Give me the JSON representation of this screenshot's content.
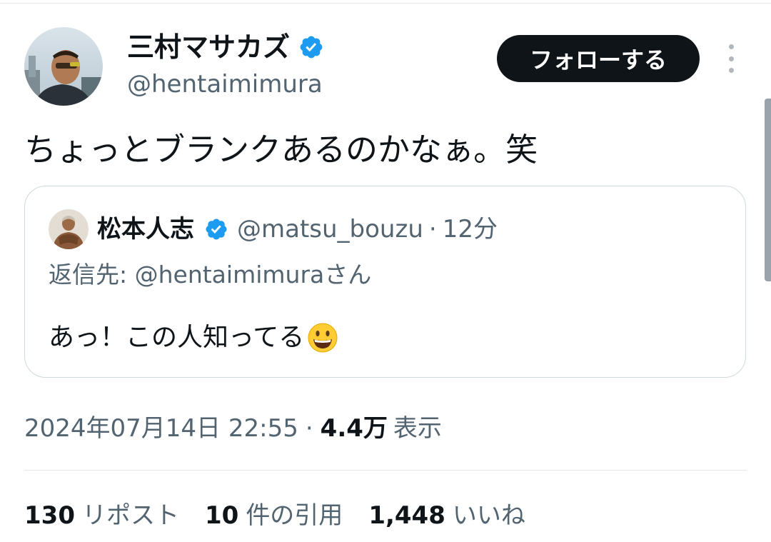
{
  "author": {
    "name": "三村マサカズ",
    "handle": "@hentaimimura",
    "verified": true
  },
  "follow_label": "フォローする",
  "tweet_text": "ちょっとブランクあるのかなぁ。笑",
  "quoted": {
    "name": "松本人志",
    "handle": "@matsu_bouzu",
    "separator": "·",
    "time": "12分",
    "reply_to": "返信先: @hentaimimuraさん",
    "text": "あっ！この人知ってる",
    "emoji": "grinning-face-icon"
  },
  "meta": {
    "timestamp": "2024年07月14日 22:55",
    "separator": "·",
    "views": "4.4万",
    "views_label": "表示"
  },
  "stats": {
    "reposts": "130",
    "reposts_label": "リポスト",
    "quotes": "10",
    "quotes_label": "件の引用",
    "likes": "1,448",
    "likes_label": "いいね"
  },
  "colors": {
    "text": "#0f1419",
    "secondary": "#536471",
    "verified": "#1d9bf0",
    "button_bg": "#0f1419",
    "border": "#cfd9de"
  }
}
